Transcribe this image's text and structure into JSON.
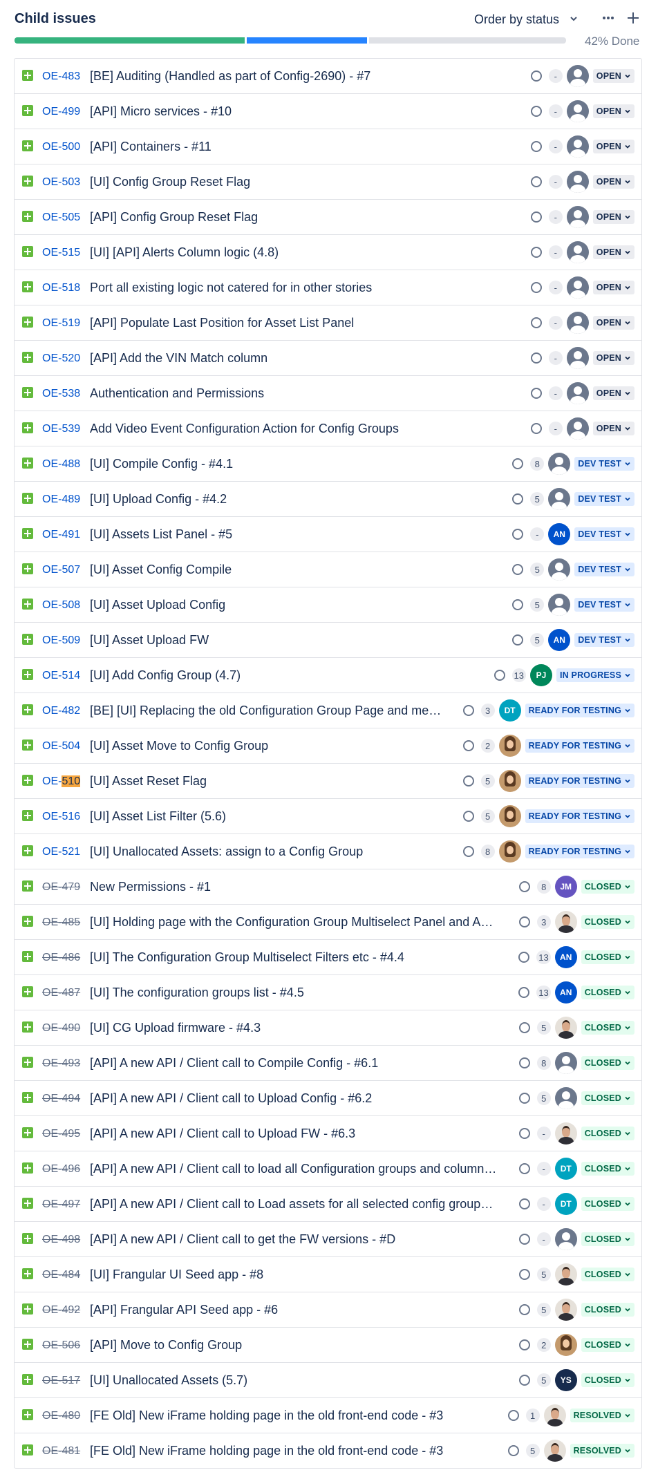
{
  "header": {
    "title": "Child issues",
    "order_label": "Order by status",
    "progress_label": "42% Done"
  },
  "progress": {
    "done_fraction": 0.42,
    "in_progress_fraction": 0.22,
    "todo_fraction": 0.36
  },
  "colors": {
    "done": "#36b37e",
    "in_progress": "#2684ff",
    "todo": "#dfe1e6",
    "story_icon": "#63ba3c",
    "link": "#0052cc"
  },
  "status_labels": {
    "open": "OPEN",
    "devtest": "DEV TEST",
    "inprogress": "IN PROGRESS",
    "rft": "READY FOR TESTING",
    "closed": "CLOSED",
    "resolved": "RESOLVED"
  },
  "issues": [
    {
      "key": "OE-483",
      "summary": "[BE] Auditing (Handled as part of Config-2690) - #7",
      "estimate": "-",
      "assignee": "unassigned",
      "initials": "",
      "status": "open",
      "strike": false
    },
    {
      "key": "OE-499",
      "summary": "[API] Micro services - #10",
      "estimate": "-",
      "assignee": "unassigned",
      "initials": "",
      "status": "open",
      "strike": false
    },
    {
      "key": "OE-500",
      "summary": "[API] Containers - #11",
      "estimate": "-",
      "assignee": "unassigned",
      "initials": "",
      "status": "open",
      "strike": false
    },
    {
      "key": "OE-503",
      "summary": "[UI] Config Group Reset Flag",
      "estimate": "-",
      "assignee": "unassigned",
      "initials": "",
      "status": "open",
      "strike": false
    },
    {
      "key": "OE-505",
      "summary": "[API] Config Group Reset Flag",
      "estimate": "-",
      "assignee": "unassigned",
      "initials": "",
      "status": "open",
      "strike": false
    },
    {
      "key": "OE-515",
      "summary": "[UI] [API] Alerts Column logic (4.8)",
      "estimate": "-",
      "assignee": "unassigned",
      "initials": "",
      "status": "open",
      "strike": false
    },
    {
      "key": "OE-518",
      "summary": "Port all existing logic not catered for in other stories",
      "estimate": "-",
      "assignee": "unassigned",
      "initials": "",
      "status": "open",
      "strike": false
    },
    {
      "key": "OE-519",
      "summary": "[API] Populate Last Position for Asset List Panel",
      "estimate": "-",
      "assignee": "unassigned",
      "initials": "",
      "status": "open",
      "strike": false
    },
    {
      "key": "OE-520",
      "summary": "[API] Add the VIN Match column",
      "estimate": "-",
      "assignee": "unassigned",
      "initials": "",
      "status": "open",
      "strike": false
    },
    {
      "key": "OE-538",
      "summary": "Authentication and Permissions",
      "estimate": "-",
      "assignee": "unassigned",
      "initials": "",
      "status": "open",
      "strike": false
    },
    {
      "key": "OE-539",
      "summary": "Add Video Event Configuration Action for Config Groups",
      "estimate": "-",
      "assignee": "unassigned",
      "initials": "",
      "status": "open",
      "strike": false
    },
    {
      "key": "OE-488",
      "summary": "[UI] Compile Config - #4.1",
      "estimate": "8",
      "assignee": "unassigned",
      "initials": "",
      "status": "devtest",
      "strike": false
    },
    {
      "key": "OE-489",
      "summary": "[UI] Upload Config - #4.2",
      "estimate": "5",
      "assignee": "unassigned",
      "initials": "",
      "status": "devtest",
      "strike": false
    },
    {
      "key": "OE-491",
      "summary": "[UI] Assets List Panel - #5",
      "estimate": "-",
      "assignee": "initials",
      "initials": "AN",
      "color": "#0052cc",
      "status": "devtest",
      "strike": false
    },
    {
      "key": "OE-507",
      "summary": "[UI] Asset Config Compile",
      "estimate": "5",
      "assignee": "unassigned",
      "initials": "",
      "status": "devtest",
      "strike": false
    },
    {
      "key": "OE-508",
      "summary": "[UI] Asset Upload Config",
      "estimate": "5",
      "assignee": "unassigned",
      "initials": "",
      "status": "devtest",
      "strike": false
    },
    {
      "key": "OE-509",
      "summary": "[UI] Asset Upload FW",
      "estimate": "5",
      "assignee": "initials",
      "initials": "AN",
      "color": "#0052cc",
      "status": "devtest",
      "strike": false
    },
    {
      "key": "OE-514",
      "summary": "[UI] Add Config Group (4.7)",
      "estimate": "13",
      "assignee": "initials",
      "initials": "PJ",
      "color": "#00875a",
      "status": "inprogress",
      "strike": false
    },
    {
      "key": "OE-482",
      "summary": "[BE] [UI] Replacing the old Configuration Group Page and men...",
      "estimate": "3",
      "assignee": "initials",
      "initials": "DT",
      "color": "#00a3bf",
      "status": "rft",
      "strike": false
    },
    {
      "key": "OE-504",
      "summary": "[UI] Asset Move to Config Group",
      "estimate": "2",
      "assignee": "photo-f",
      "initials": "",
      "status": "rft",
      "strike": false
    },
    {
      "key": "OE-510",
      "summary": "[UI] Asset Reset Flag",
      "estimate": "5",
      "assignee": "photo-f",
      "initials": "",
      "status": "rft",
      "strike": false,
      "highlight": true
    },
    {
      "key": "OE-516",
      "summary": "[UI] Asset List Filter (5.6)",
      "estimate": "5",
      "assignee": "photo-f",
      "initials": "",
      "status": "rft",
      "strike": false
    },
    {
      "key": "OE-521",
      "summary": "[UI] Unallocated Assets: assign to a Config Group",
      "estimate": "8",
      "assignee": "photo-f",
      "initials": "",
      "status": "rft",
      "strike": false
    },
    {
      "key": "OE-479",
      "summary": "New Permissions - #1",
      "estimate": "8",
      "assignee": "initials",
      "initials": "JM",
      "color": "#6554c0",
      "status": "closed",
      "strike": true
    },
    {
      "key": "OE-485",
      "summary": "[UI] Holding page with the Configuration Group Multiselect Panel and Ass...",
      "estimate": "3",
      "assignee": "photo-m",
      "initials": "",
      "status": "closed",
      "strike": true
    },
    {
      "key": "OE-486",
      "summary": "[UI] The Configuration Group Multiselect Filters etc - #4.4",
      "estimate": "13",
      "assignee": "initials",
      "initials": "AN",
      "color": "#0052cc",
      "status": "closed",
      "strike": true
    },
    {
      "key": "OE-487",
      "summary": "[UI] The configuration groups list - #4.5",
      "estimate": "13",
      "assignee": "initials",
      "initials": "AN",
      "color": "#0052cc",
      "status": "closed",
      "strike": true
    },
    {
      "key": "OE-490",
      "summary": "[UI] CG Upload firmware - #4.3",
      "estimate": "5",
      "assignee": "photo-m",
      "initials": "",
      "status": "closed",
      "strike": true
    },
    {
      "key": "OE-493",
      "summary": "[API] A new API / Client call to Compile Config - #6.1",
      "estimate": "8",
      "assignee": "unassigned",
      "initials": "",
      "status": "closed",
      "strike": true
    },
    {
      "key": "OE-494",
      "summary": "[API] A new API / Client call to Upload Config - #6.2",
      "estimate": "5",
      "assignee": "unassigned",
      "initials": "",
      "status": "closed",
      "strike": true
    },
    {
      "key": "OE-495",
      "summary": "[API] A new API / Client call to Upload FW - #6.3",
      "estimate": "-",
      "assignee": "photo-m",
      "initials": "",
      "status": "closed",
      "strike": true
    },
    {
      "key": "OE-496",
      "summary": "[API] A new API / Client call to load all Configuration groups and columns ...",
      "estimate": "-",
      "assignee": "initials",
      "initials": "DT",
      "color": "#00a3bf",
      "status": "closed",
      "strike": true
    },
    {
      "key": "OE-497",
      "summary": "[API] A new API / Client call to Load assets for all selected config groups - ...",
      "estimate": "-",
      "assignee": "initials",
      "initials": "DT",
      "color": "#00a3bf",
      "status": "closed",
      "strike": true
    },
    {
      "key": "OE-498",
      "summary": "[API] A new API / Client call to get the FW versions - #D",
      "estimate": "-",
      "assignee": "unassigned",
      "initials": "",
      "status": "closed",
      "strike": true
    },
    {
      "key": "OE-484",
      "summary": "[UI] Frangular UI Seed app - #8",
      "estimate": "5",
      "assignee": "photo-m",
      "initials": "",
      "status": "closed",
      "strike": true
    },
    {
      "key": "OE-492",
      "summary": "[API] Frangular API Seed app - #6",
      "estimate": "5",
      "assignee": "photo-m",
      "initials": "",
      "status": "closed",
      "strike": true
    },
    {
      "key": "OE-506",
      "summary": "[API] Move to Config Group",
      "estimate": "2",
      "assignee": "photo-f",
      "initials": "",
      "status": "closed",
      "strike": true
    },
    {
      "key": "OE-517",
      "summary": "[UI] Unallocated Assets (5.7)",
      "estimate": "5",
      "assignee": "initials",
      "initials": "YS",
      "color": "#172b4d",
      "status": "closed",
      "strike": true
    },
    {
      "key": "OE-480",
      "summary": "[FE Old] New iFrame holding page in the old front-end code - #3",
      "estimate": "1",
      "assignee": "photo-m",
      "initials": "",
      "status": "resolved",
      "strike": true
    },
    {
      "key": "OE-481",
      "summary": "[FE Old] New iFrame holding page in the old front-end code - #3",
      "estimate": "5",
      "assignee": "photo-m",
      "initials": "",
      "status": "resolved",
      "strike": true
    }
  ]
}
